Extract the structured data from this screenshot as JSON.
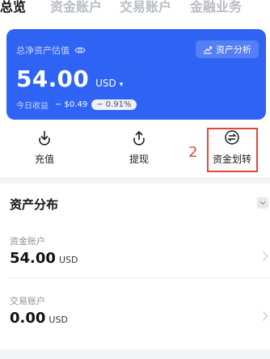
{
  "tabs": [
    {
      "label": "总览",
      "active": true
    },
    {
      "label": "资金账户",
      "active": false
    },
    {
      "label": "交易账户",
      "active": false
    },
    {
      "label": "金融业务",
      "active": false
    }
  ],
  "card": {
    "label": "总净资产估值",
    "analysis_label": "资产分析",
    "total": "54.00",
    "currency": "USD",
    "caret": "▾",
    "profit_label": "今日收益",
    "profit_value": "− $0.49",
    "profit_percent": "− 0.91%"
  },
  "actions": [
    {
      "label": "充值",
      "icon": "deposit-icon"
    },
    {
      "label": "提现",
      "icon": "withdraw-icon"
    },
    {
      "label": "资金划转",
      "icon": "transfer-icon"
    }
  ],
  "annotation": {
    "number": "2"
  },
  "distribution": {
    "title": "资产分布",
    "rows": [
      {
        "label": "资金账户",
        "amount": "54.00",
        "unit": "USD"
      },
      {
        "label": "交易账户",
        "amount": "0.00",
        "unit": "USD"
      }
    ]
  },
  "colors": {
    "accent": "#2f63f3",
    "annotation": "#e5463b"
  }
}
